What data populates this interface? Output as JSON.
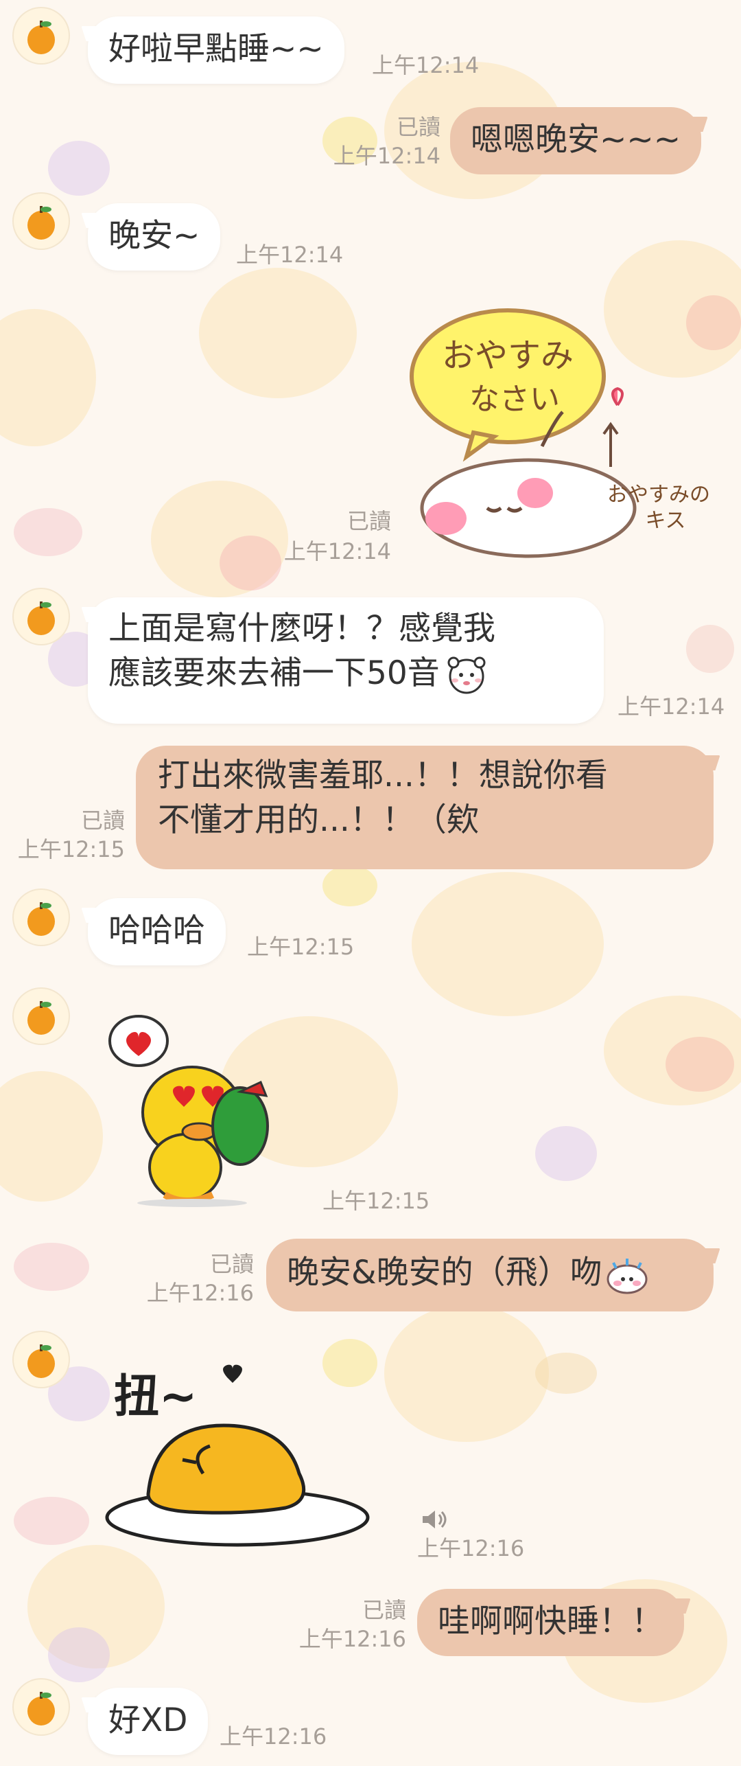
{
  "messages": [
    {
      "kind": "text",
      "side": "received",
      "text": "好啦早點睡~~",
      "time": "上午12:14"
    },
    {
      "kind": "text",
      "side": "sent",
      "text": "嗯嗯晚安~~~",
      "read": "已讀",
      "time": "上午12:14"
    },
    {
      "kind": "text",
      "side": "received",
      "text": "晚安~",
      "time": "上午12:14"
    },
    {
      "kind": "sticker",
      "side": "sent",
      "sticker_text": [
        "おやすみ",
        "なさい",
        "おやすみの",
        "キス"
      ],
      "read": "已讀",
      "time": "上午12:14"
    },
    {
      "kind": "text",
      "side": "received",
      "lines": [
        "上面是寫什麼呀！？感覺我",
        "應該要來去補一下50音"
      ],
      "emoji": "bear-face-icon",
      "time": "上午12:14"
    },
    {
      "kind": "text",
      "side": "sent",
      "lines": [
        "打出來微害羞耶...！！想說你看",
        "不懂才用的...！！（欸"
      ],
      "read": "已讀",
      "time": "上午12:15"
    },
    {
      "kind": "text",
      "side": "received",
      "text": "哈哈哈",
      "time": "上午12:15"
    },
    {
      "kind": "sticker",
      "side": "received",
      "sticker": "duck-heart-sticker",
      "time": "上午12:15"
    },
    {
      "kind": "text",
      "side": "sent",
      "text": "晚安&晚安的（飛）吻",
      "emoji": "sweat-face-icon",
      "read": "已讀",
      "time": "上午12:16"
    },
    {
      "kind": "sticker",
      "side": "received",
      "sticker": "gudetama-sticker",
      "sticker_text": "扭~",
      "time": "上午12:16",
      "icon": "speaker-icon"
    },
    {
      "kind": "text",
      "side": "sent",
      "text": "哇啊啊快睡！！",
      "read": "已讀",
      "time": "上午12:16"
    },
    {
      "kind": "text",
      "side": "received",
      "text": "好XD",
      "time": "上午12:16"
    }
  ],
  "colors": {
    "background": "#fdf7f0",
    "received_bubble": "#ffffff",
    "sent_bubble": "#ecc6ad",
    "meta_text": "#a79f98"
  }
}
